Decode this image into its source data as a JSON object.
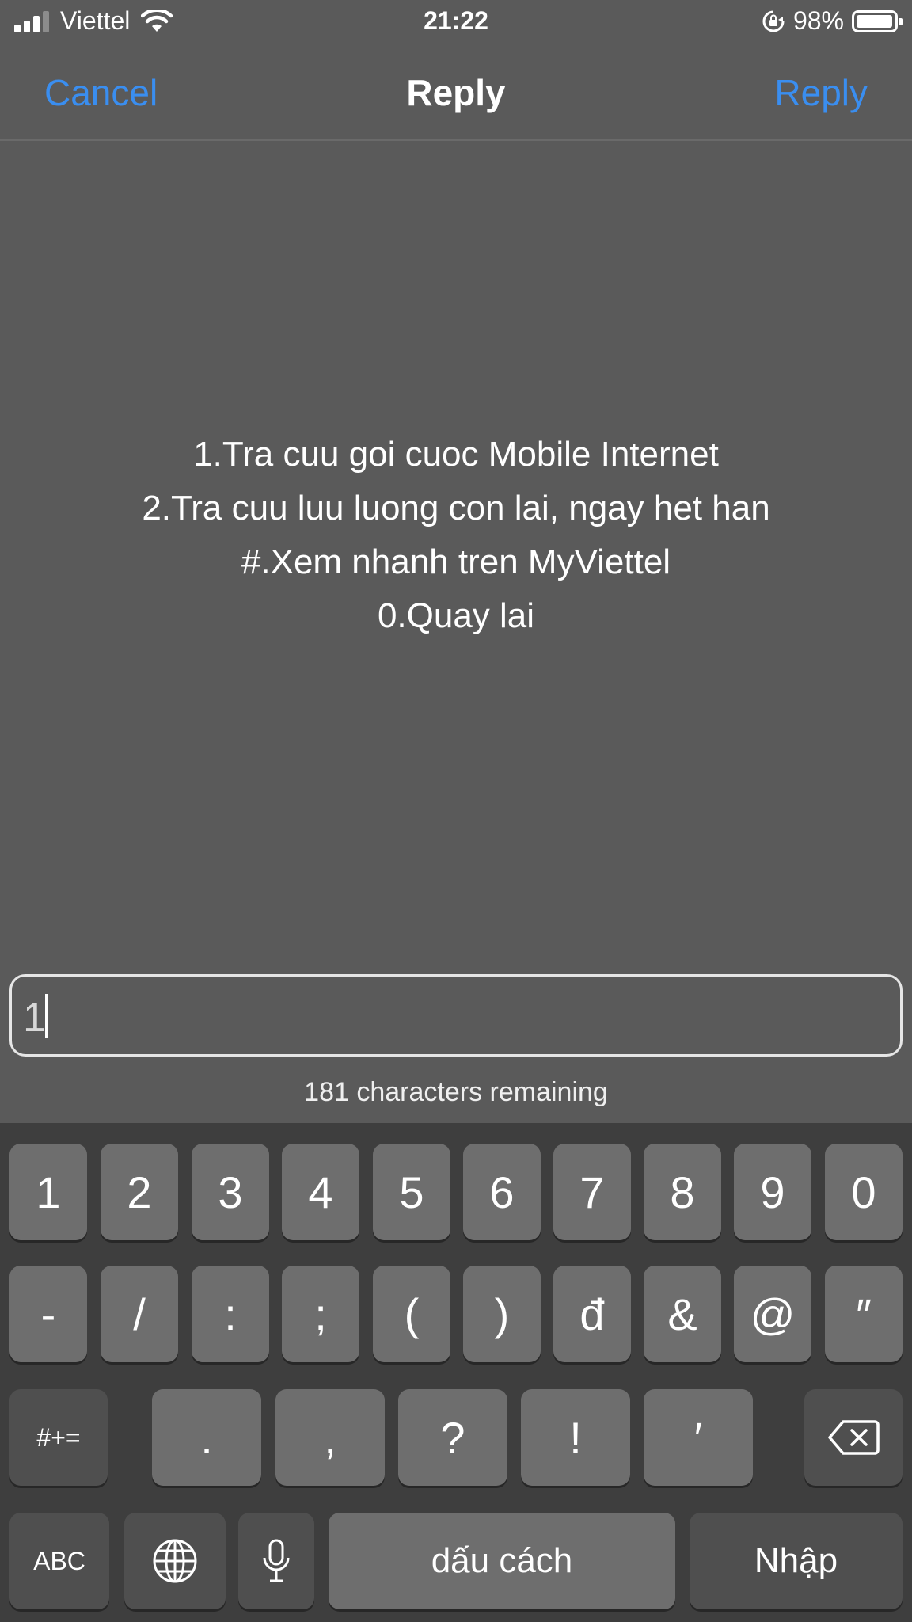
{
  "status_bar": {
    "carrier": "Viettel",
    "time": "21:22",
    "battery_percent": "98%",
    "battery_level": 0.98,
    "icons": [
      "signal-icon",
      "wifi-icon",
      "rotation-lock-icon",
      "battery-icon"
    ]
  },
  "nav": {
    "cancel_label": "Cancel",
    "title": "Reply",
    "reply_label": "Reply",
    "accent_color": "#3a8ef0"
  },
  "message": {
    "lines": [
      "1.Tra cuu goi cuoc Mobile Internet",
      "2.Tra cuu luu luong con lai, ngay het han",
      "#.Xem nhanh tren MyViettel",
      "0.Quay lai"
    ]
  },
  "input": {
    "value": "1"
  },
  "char_remaining": "181 characters remaining",
  "keyboard": {
    "row1": [
      "1",
      "2",
      "3",
      "4",
      "5",
      "6",
      "7",
      "8",
      "9",
      "0"
    ],
    "row2": [
      "-",
      "/",
      ":",
      ";",
      "(",
      ")",
      "đ",
      "&",
      "@",
      "″"
    ],
    "row3": {
      "symbols": "#+=",
      "keys": [
        ".",
        ",",
        "?",
        "!",
        "′"
      ],
      "delete_icon": "backspace-icon"
    },
    "row4": {
      "abc": "ABC",
      "globe_icon": "globe-icon",
      "mic_icon": "microphone-icon",
      "space": "dấu cách",
      "return": "Nhập"
    }
  }
}
